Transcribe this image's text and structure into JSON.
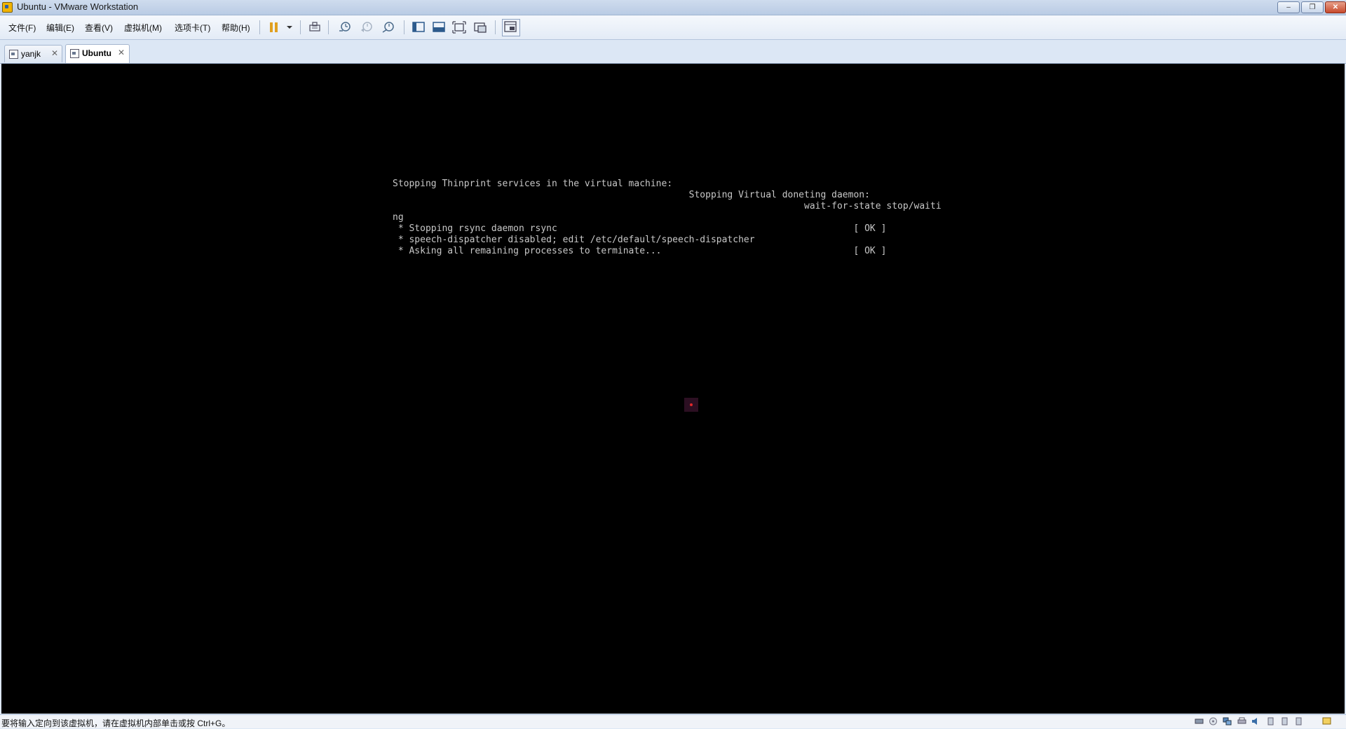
{
  "window": {
    "title": "Ubuntu - VMware Workstation",
    "minimize_label": "–",
    "restore_label": "❐",
    "close_label": "✕"
  },
  "menu": {
    "items": [
      "文件(F)",
      "编辑(E)",
      "查看(V)",
      "虚拟机(M)",
      "选项卡(T)",
      "帮助(H)"
    ]
  },
  "toolbar": {
    "icons": [
      "pause-icon",
      "dropdown-arrow-icon",
      "send-ctrl-alt-del-icon",
      "snapshot-take-icon",
      "snapshot-revert-icon",
      "snapshot-manager-icon",
      "sidebar-toggle-icon",
      "console-view-icon",
      "fullscreen-icon",
      "unity-icon",
      "thumbnail-view-icon"
    ]
  },
  "tabs": [
    {
      "label": "yanjk",
      "active": false,
      "close": "✕"
    },
    {
      "label": "Ubuntu",
      "active": true,
      "close": "✕"
    }
  ],
  "console": {
    "lines": [
      "Stopping Thinprint services in the virtual machine:",
      "                                                      Stopping Virtual doneting daemon:",
      "                                                                           wait-for-state stop/waiti",
      "ng",
      " * Stopping rsync daemon rsync                                                      [ OK ]",
      " * speech-dispatcher disabled; edit /etc/default/speech-dispatcher",
      " * Asking all remaining processes to terminate...                                   [ OK ]"
    ]
  },
  "statusbar": {
    "hint": "要将输入定向到该虚拟机，请在虚拟机内部单击或按 Ctrl+G。",
    "icons": [
      "hard-disk-icon",
      "cd-rom-icon",
      "network-icon",
      "printer-icon",
      "sound-icon",
      "usb-device-icon",
      "usb-device-icon",
      "usb-device-icon",
      "message-icon"
    ]
  },
  "colors": {
    "console_background": "#000000",
    "console_text": "#c8c8c8",
    "chrome_background": "#dce7f5"
  }
}
